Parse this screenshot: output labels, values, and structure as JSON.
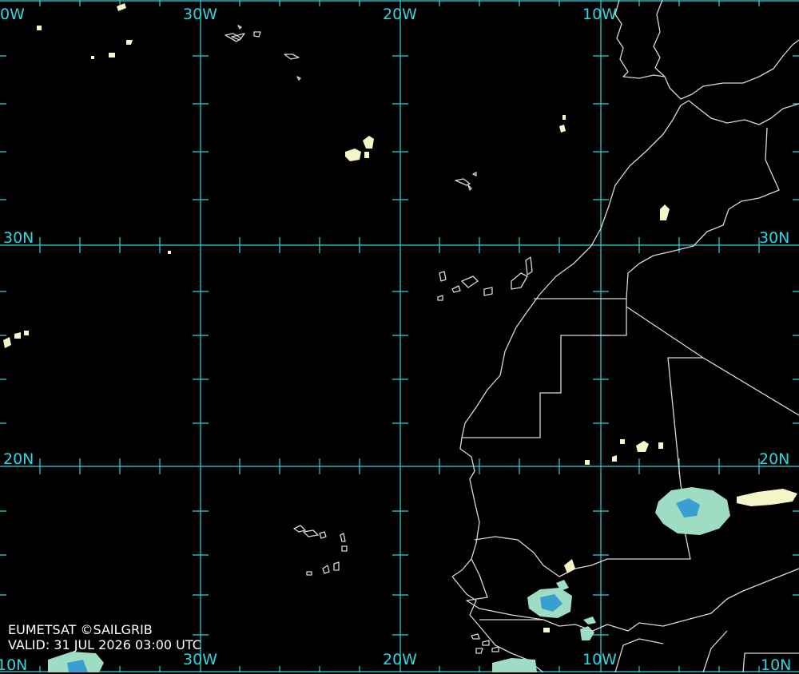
{
  "map": {
    "grid_color": "#2fd5e0",
    "coast_color": "#d8d8d8",
    "cloud_light_color": "#f4f6c8",
    "cloud_mid_color": "#9fdcc4",
    "cloud_dark_color": "#3a9fd0",
    "longitude_labels_top": [
      "0W",
      "30W",
      "20W",
      "10W"
    ],
    "longitude_labels_bottom": [
      "10N",
      "30W",
      "20W",
      "10W",
      "10N"
    ],
    "latitude_labels_left": [
      "30N",
      "20N"
    ],
    "latitude_labels_right": [
      "30N",
      "20N"
    ]
  },
  "footer": {
    "credit": "EUMETSAT ©SAILGRIB",
    "valid": "VALID:  31 JUL 2026 03:00 UTC"
  }
}
